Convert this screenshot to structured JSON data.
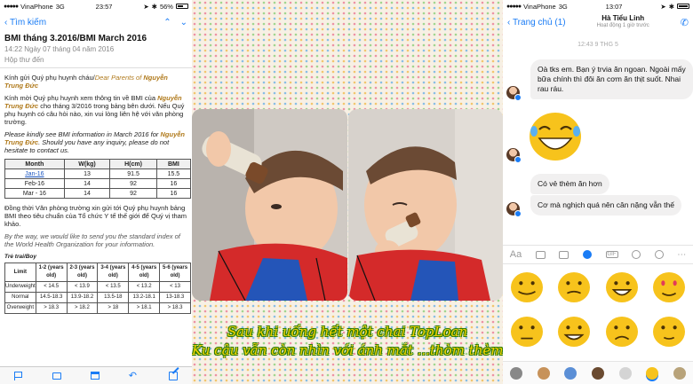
{
  "mail": {
    "status": {
      "carrier": "VinaPhone",
      "network": "3G",
      "time": "23:57",
      "battery": "56%"
    },
    "nav": {
      "back": "Tìm kiếm"
    },
    "subject": "BMI tháng 3.2016/BMI March 2016",
    "date": "14:22 Ngày 07 tháng 04 năm 2016",
    "mailbox": "Hộp thư đến",
    "body": {
      "greeting_vi": "Kính gửi Quý phụ huynh cháu/",
      "greeting_en": "Dear Parents of",
      "name_part1": "Nguyễn Trung",
      "name_part2": "Đức",
      "para1_a": "Kính mời Quý phụ huynh xem thông tin về BMI của",
      "para1_name": "Nguyễn Trung Đức",
      "para1_b": "cho tháng 3/2016 trong bảng bên dưới. Nếu Quý phụ huynh có câu hỏi nào, xin vui lòng liên hệ với văn phòng trường.",
      "para2_a": "Please kindly see BMI information in March 2016  for",
      "para2_name": "Nguyễn Trung Đức",
      "para2_b": ". Should you have any inquiry, please do not hesitate to contact us.",
      "para3": "Đồng thời Văn phòng trường xin gửi tới Quý phụ huynh bảng BMI theo tiêu chuẩn của Tổ chức Y tế thế giới để Quý vị tham khảo.",
      "para4": "By the way, we would like to send you the standard index of the World Health Organization for your information.",
      "chart_label": "Trẻ trai/Boy"
    },
    "bmi_table": {
      "headers": [
        "Month",
        "W(kg)",
        "H(cm)",
        "BMI"
      ],
      "rows": [
        [
          "Jan-16",
          "13",
          "91.5",
          "15.5"
        ],
        [
          "Feb-16",
          "14",
          "92",
          "16"
        ],
        [
          "Mar - 16",
          "14",
          "92",
          "16"
        ]
      ]
    },
    "ref_table": {
      "headers": [
        "Limit",
        "1-2 (years old)",
        "2-3 (years old)",
        "3-4 (years old)",
        "4-5 (years old)",
        "5-6 (years old)"
      ],
      "rows": [
        [
          "Underweight",
          "< 14.5",
          "< 13.9",
          "< 13.5",
          "< 13.2",
          "< 13"
        ],
        [
          "Normal",
          "14.5-18.3",
          "13.9-18.2",
          "13.5-18",
          "13.2-18.1",
          "13-18.3"
        ],
        [
          "Overweight",
          "> 18.3",
          "> 18.2",
          "> 18",
          "> 18.1",
          "> 18.3"
        ]
      ]
    }
  },
  "collage": {
    "caption_line1": "Sau khi uống hết một chai TopLoan",
    "caption_line2": "Ku cậu vẫn còn nhìn với ánh mắt ...thòm thèm"
  },
  "chat": {
    "status": {
      "carrier": "VinaPhone",
      "network": "3G",
      "time": "13:07"
    },
    "nav": {
      "back": "Trang chủ (1)",
      "contact_name": "Hà Tiểu Linh",
      "contact_status": "Hoạt động 1 giờ trước"
    },
    "timestamp": "12:43 9 THG 5",
    "messages": [
      {
        "text": "Oà tks em. Bạn ý trvia ăn ngoan. Ngoài mấy bữa chính thì đôi ăn cơm ăn thịt suốt. Nhai rau ráu."
      },
      {
        "text": "Có vẻ thèm ăn hơn"
      },
      {
        "text": "Cơ mà nghịch quá nên cân nặng vẫn thế"
      }
    ],
    "composer_placeholder": "Aa",
    "composer_gif": "GIF",
    "colors": {
      "accent": "#1a7cf5",
      "emoji": "#f7c31c"
    }
  }
}
